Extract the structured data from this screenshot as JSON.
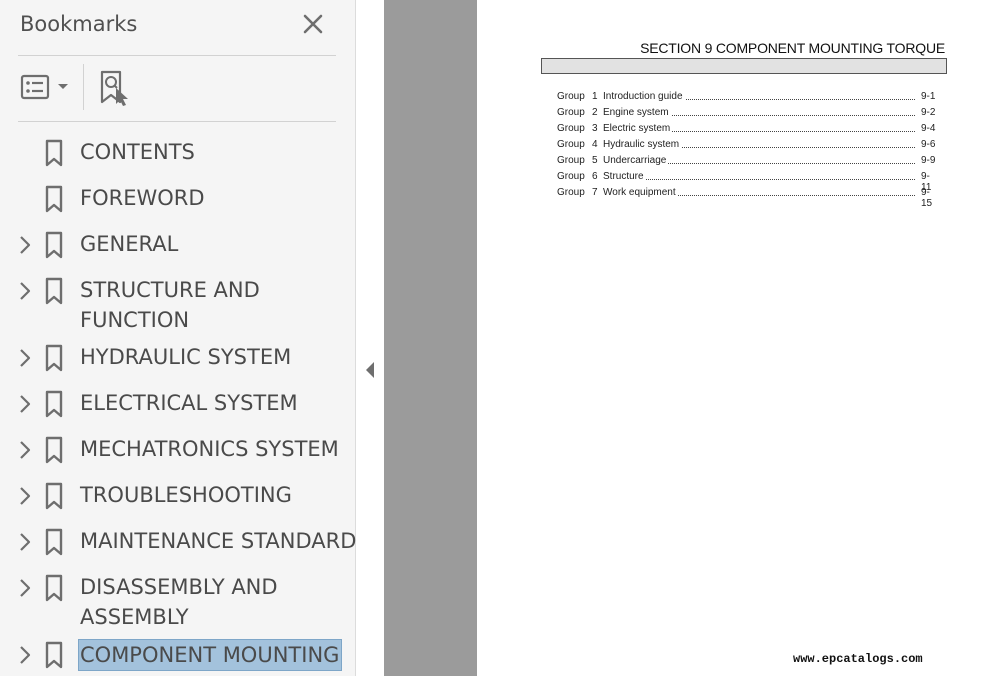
{
  "bookmarks_panel": {
    "title": "Bookmarks",
    "items": [
      {
        "label_lines": [
          "CONTENTS"
        ],
        "expandable": false,
        "selected": false
      },
      {
        "label_lines": [
          "FOREWORD"
        ],
        "expandable": false,
        "selected": false
      },
      {
        "label_lines": [
          "GENERAL"
        ],
        "expandable": true,
        "selected": false
      },
      {
        "label_lines": [
          "STRUCTURE AND",
          "FUNCTION"
        ],
        "expandable": true,
        "selected": false
      },
      {
        "label_lines": [
          "HYDRAULIC SYSTEM"
        ],
        "expandable": true,
        "selected": false
      },
      {
        "label_lines": [
          "ELECTRICAL SYSTEM"
        ],
        "expandable": true,
        "selected": false
      },
      {
        "label_lines": [
          "MECHATRONICS SYSTEM"
        ],
        "expandable": true,
        "selected": false
      },
      {
        "label_lines": [
          "TROUBLESHOOTING"
        ],
        "expandable": true,
        "selected": false
      },
      {
        "label_lines": [
          "MAINTENANCE STANDARD"
        ],
        "expandable": true,
        "selected": false
      },
      {
        "label_lines": [
          "DISASSEMBLY AND",
          "ASSEMBLY"
        ],
        "expandable": true,
        "selected": false
      },
      {
        "label_lines": [
          "COMPONENT MOUNTING"
        ],
        "expandable": true,
        "selected": true
      }
    ]
  },
  "document_page": {
    "section_title": "SECTION   9  COMPONENT MOUNTING TORQUE",
    "toc": [
      {
        "group": "Group",
        "num": "1",
        "title": "Introduction guide",
        "page": "9-1"
      },
      {
        "group": "Group",
        "num": "2",
        "title": "Engine system",
        "page": "9-2"
      },
      {
        "group": "Group",
        "num": "3",
        "title": "Electric system",
        "page": "9-4"
      },
      {
        "group": "Group",
        "num": "4",
        "title": "Hydraulic system",
        "page": "9-6"
      },
      {
        "group": "Group",
        "num": "5",
        "title": "Undercarriage",
        "page": "9-9"
      },
      {
        "group": "Group",
        "num": "6",
        "title": "Structure",
        "page": "9-11"
      },
      {
        "group": "Group",
        "num": "7",
        "title": "Work equipment",
        "page": "9-15"
      }
    ],
    "watermark": "www.epcatalogs.com"
  },
  "colors": {
    "panel_bg": "#f5f5f5",
    "selection_bg": "#a3c2dc",
    "gutter": "#9b9b9b",
    "icon": "#6e6e6e"
  },
  "icons": [
    "close-icon",
    "bookmark-options-icon",
    "chevron-down-icon",
    "find-bookmark-icon",
    "chevron-right-icon",
    "bookmark-icon",
    "collapse-panel-icon"
  ]
}
